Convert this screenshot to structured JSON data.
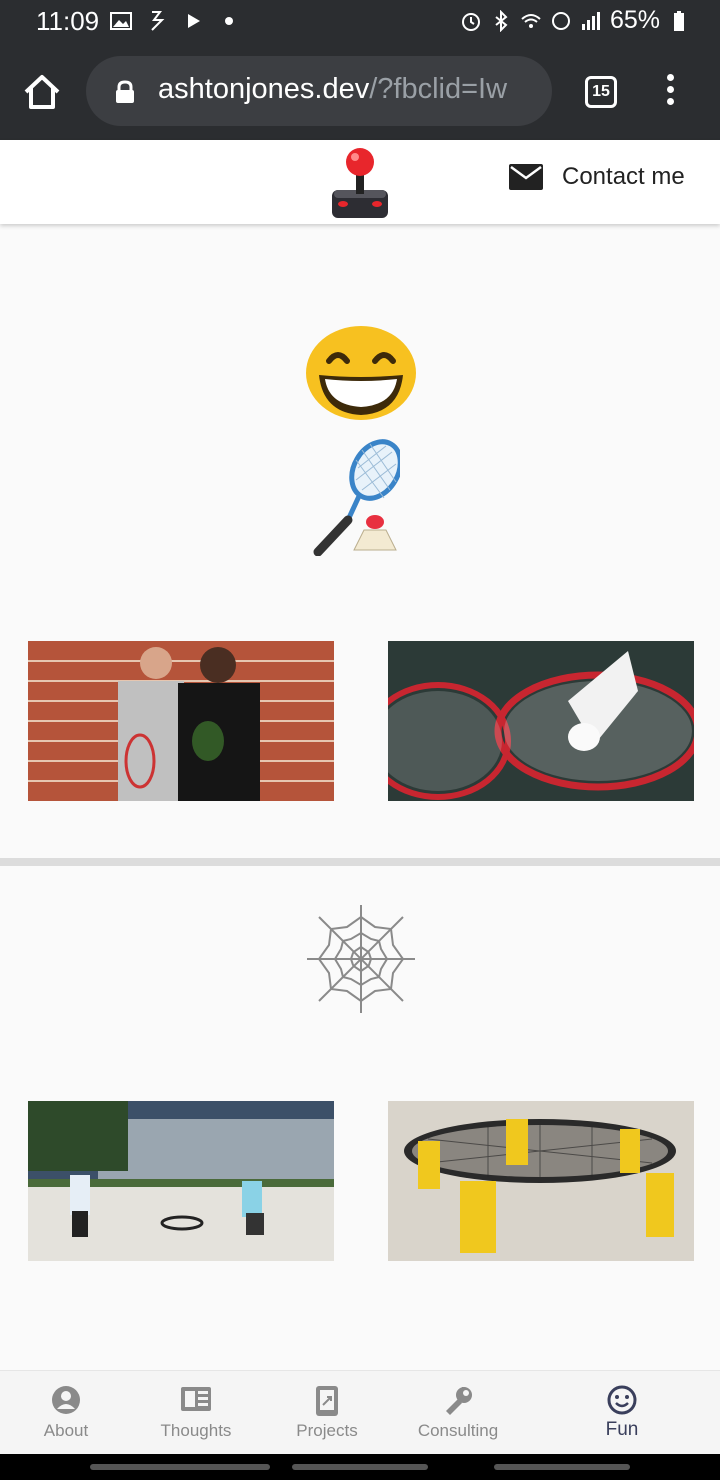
{
  "status_bar": {
    "time": "11:09",
    "battery": "65%"
  },
  "browser": {
    "url_host": "ashtonjones.dev",
    "url_path": "/?fbclid=Iw",
    "tab_count": "15"
  },
  "header": {
    "logo_icon": "joystick-icon",
    "contact_label": "Contact me"
  },
  "sections": [
    {
      "icons": [
        "grinning-face-icon",
        "badminton-icon"
      ],
      "photos": [
        "badminton-players-photo",
        "badminton-rackets-photo"
      ]
    },
    {
      "icons": [
        "spider-web-icon"
      ],
      "photos": [
        "spikeball-game-photo",
        "spikeball-net-photo"
      ]
    }
  ],
  "bottom_nav": {
    "items": [
      {
        "label": "About",
        "icon": "account-circle-icon"
      },
      {
        "label": "Thoughts",
        "icon": "article-icon"
      },
      {
        "label": "Projects",
        "icon": "project-icon"
      },
      {
        "label": "Consulting",
        "icon": "wrench-icon"
      },
      {
        "label": "Fun",
        "icon": "smiley-icon"
      }
    ],
    "active": "Fun"
  },
  "colors": {
    "status_bg": "#2b2d30",
    "nav_active": "#3a3f5c",
    "nav_inactive": "#8a8a8a"
  }
}
